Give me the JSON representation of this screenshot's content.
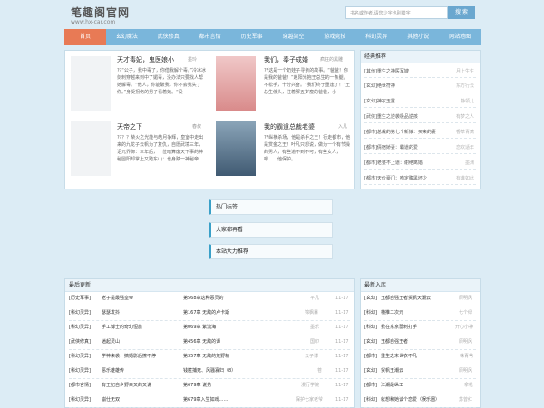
{
  "site": {
    "title": "笔趣阁官网",
    "url": "www.hx-car.com"
  },
  "search": {
    "placeholder": "书名或作者,请您少字也别错字",
    "button": "搜 索"
  },
  "nav": [
    "首页",
    "玄幻魔法",
    "武侠修真",
    "都市言情",
    "历史军事",
    "穿越架空",
    "游戏竞技",
    "科幻灵异",
    "其他小说",
    "网站地图"
  ],
  "featured": [
    {
      "title": "天才毒妃，鬼医娘小",
      "author": "墨玲",
      "desc": "??“公子，我中毒了，你借我解个毒。”冷冰冰剑刺穿越来到中了媚毒，没办法只要找人帮她解毒。“他人，你能破我，你不会我失了你。”身受拐伤的男子看着她。“没"
    },
    {
      "title": "我们，奉子成婚",
      "author": "疯狂的黑雕",
      "desc": "??这是一个奶娃子寻亲的故事。“爸爸！你是我的爸爸！”赵阳光抱王总生的一条腿，不松手，十分兴奋。“我们终于重逢了！”王总生低头，注着那五岁瘦的爸爸，小"
    },
    {
      "title": "天帝之下",
      "author": "春叔",
      "desc": "??？？柴火之光能与皓月争辉，皇室中走出来的九龙子云帆为了复仇，自愿武境三年，诏元界御：三年后，一位暗算废天下事的神秘圆阳却掌上又踏东山：也身赋一神秘帝"
    },
    {
      "title": "我的霸道总裁老婆",
      "author": "入凡",
      "desc": "??纵横杀场，他是杀手之王！行走都市，他是赏金之王！叶凡只想说，做为一个有节操的男人，有些追不到不可，有些女人，嗯……他保护。"
    }
  ],
  "classic": {
    "heading": "经典推荐",
    "items": [
      {
        "cat": "[其他]",
        "title": "重生之神医军嫂",
        "author": "月上生生"
      },
      {
        "cat": "[玄幻]",
        "title": "绝世符神",
        "author": "东方行云"
      },
      {
        "cat": "[玄幻]",
        "title": "神农玉露",
        "author": "静领儿"
      },
      {
        "cat": "[武侠]",
        "title": "重生之逆袭极品逆孩",
        "author": "有梦之人"
      },
      {
        "cat": "[都市]",
        "title": "总裁的第七个新娘：买来的妻",
        "author": "香草青蒿"
      },
      {
        "cat": "[都市]",
        "title": "倩宿娇妻：霸道的爱",
        "author": "恋欢适年"
      },
      {
        "cat": "[都市]",
        "title": "老婆不上道：谢绝离婚",
        "author": "墨渊"
      },
      {
        "cat": "[都市]",
        "title": "天价豪门：吻定腹黑坏少",
        "author": "有谁如此"
      }
    ]
  },
  "tags": [
    "热门标签",
    "大家都再看",
    "本站大力推荐"
  ],
  "latest": {
    "heading": "最后更新",
    "rows": [
      {
        "cat": "[历史军事]",
        "title": "老子是最强皇帝",
        "chapter": "第568章这种恶灵的",
        "author": "平凡",
        "date": "11-17"
      },
      {
        "cat": "[科幻灵异]",
        "title": "瑟瑟发抖",
        "chapter": "第167章 无敌的卢卡斯",
        "author": "锦枫暴",
        "date": "11-17"
      },
      {
        "cat": "[科幻灵异]",
        "title": "手工博士的奇幻恒旅",
        "chapter": "第069章 紫流海",
        "author": "墨乐",
        "date": "11-17"
      },
      {
        "cat": "[武侠修真]",
        "title": "逍起灵山",
        "chapter": "第456章 无敌的谭",
        "author": "国印",
        "date": "11-17"
      },
      {
        "cat": "[科幻灵异]",
        "title": "学神来袭：搞婚影后撩不停",
        "chapter": "第357章 无敌的荒野精",
        "author": "云子博",
        "date": "11-17"
      },
      {
        "cat": "[科幻灵异]",
        "title": "恶乐雄雄传",
        "chapter": "钱箧捕死、风骚寡妇（8）",
        "author": "苍",
        "date": "11-17"
      },
      {
        "cat": "[都市言情]",
        "title": "有王妃自乡野来又的又说",
        "chapter": "第679章 说弟",
        "author": "漫行学院",
        "date": "11-17"
      },
      {
        "cat": "[科幻灵异]",
        "title": "崩仕无双",
        "chapter": "第679章入生如戏……",
        "author": "保护七家老爷",
        "date": "11-17"
      }
    ]
  },
  "newbooks": {
    "heading": "最新入库",
    "rows": [
      {
        "cat": "[玄幻]",
        "title": "玉都自强王者贸帆天潮云",
        "author": "原明风"
      },
      {
        "cat": "[科幻]",
        "title": "横推二次元",
        "author": "七个绿"
      },
      {
        "cat": "[科幻]",
        "title": "我在东京蔷刺打手",
        "author": "开心小神"
      },
      {
        "cat": "[玄幻]",
        "title": "玉都自强王者",
        "author": "原明风"
      },
      {
        "cat": "[都市]",
        "title": "重生之末世衣不凡",
        "author": "一株青苇"
      },
      {
        "cat": "[玄幻]",
        "title": "贸帆王潮云",
        "author": "原明风"
      },
      {
        "cat": "[都市]",
        "title": "江湖最纵工",
        "author": "拿枪"
      },
      {
        "cat": "[科幻]",
        "title": "就想和她谈个恋爱（娱乐圈）",
        "author": "苏曾红"
      }
    ]
  }
}
